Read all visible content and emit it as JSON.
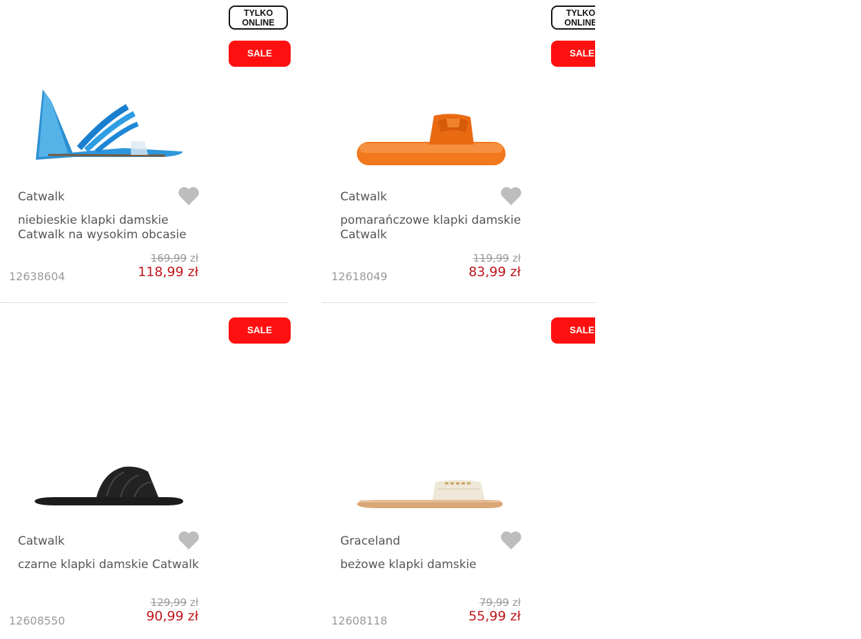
{
  "products": [
    {
      "badge_online": [
        "TYLKO",
        "ONLINE"
      ],
      "badge_sale": "SALE",
      "brand": "Catwalk",
      "name": "niebieskie klapki damskie Catwalk na wysokim obcasie",
      "old_price": "169,99",
      "old_currency": "zł",
      "price": "118,99 zł",
      "id": "12638604",
      "image_icon": "blue-heeled-sandal-icon"
    },
    {
      "badge_online": [
        "TYLKO",
        "ONLINE"
      ],
      "badge_sale": "SALE",
      "brand": "Catwalk",
      "name": "pomarańczowe klapki damskie Catwalk",
      "old_price": "119,99",
      "old_currency": "zł",
      "price": "83,99 zł",
      "id": "12618049",
      "image_icon": "orange-slide-icon"
    },
    {
      "badge_sale": "SALE",
      "brand": "Catwalk",
      "name": "czarne klapki damskie Catwalk",
      "old_price": "129,99",
      "old_currency": "zł",
      "price": "90,99 zł",
      "id": "12608550",
      "image_icon": "black-slide-icon"
    },
    {
      "badge_sale": "SALE",
      "brand": "Graceland",
      "name": "beżowe klapki damskie",
      "old_price": "79,99",
      "old_currency": "zł",
      "price": "55,99 zł",
      "id": "12608118",
      "image_icon": "beige-slide-icon"
    }
  ],
  "colors": {
    "sale_red": "#ff1010",
    "price_red": "#c0161c",
    "heart_gray": "#bdbdbd"
  }
}
